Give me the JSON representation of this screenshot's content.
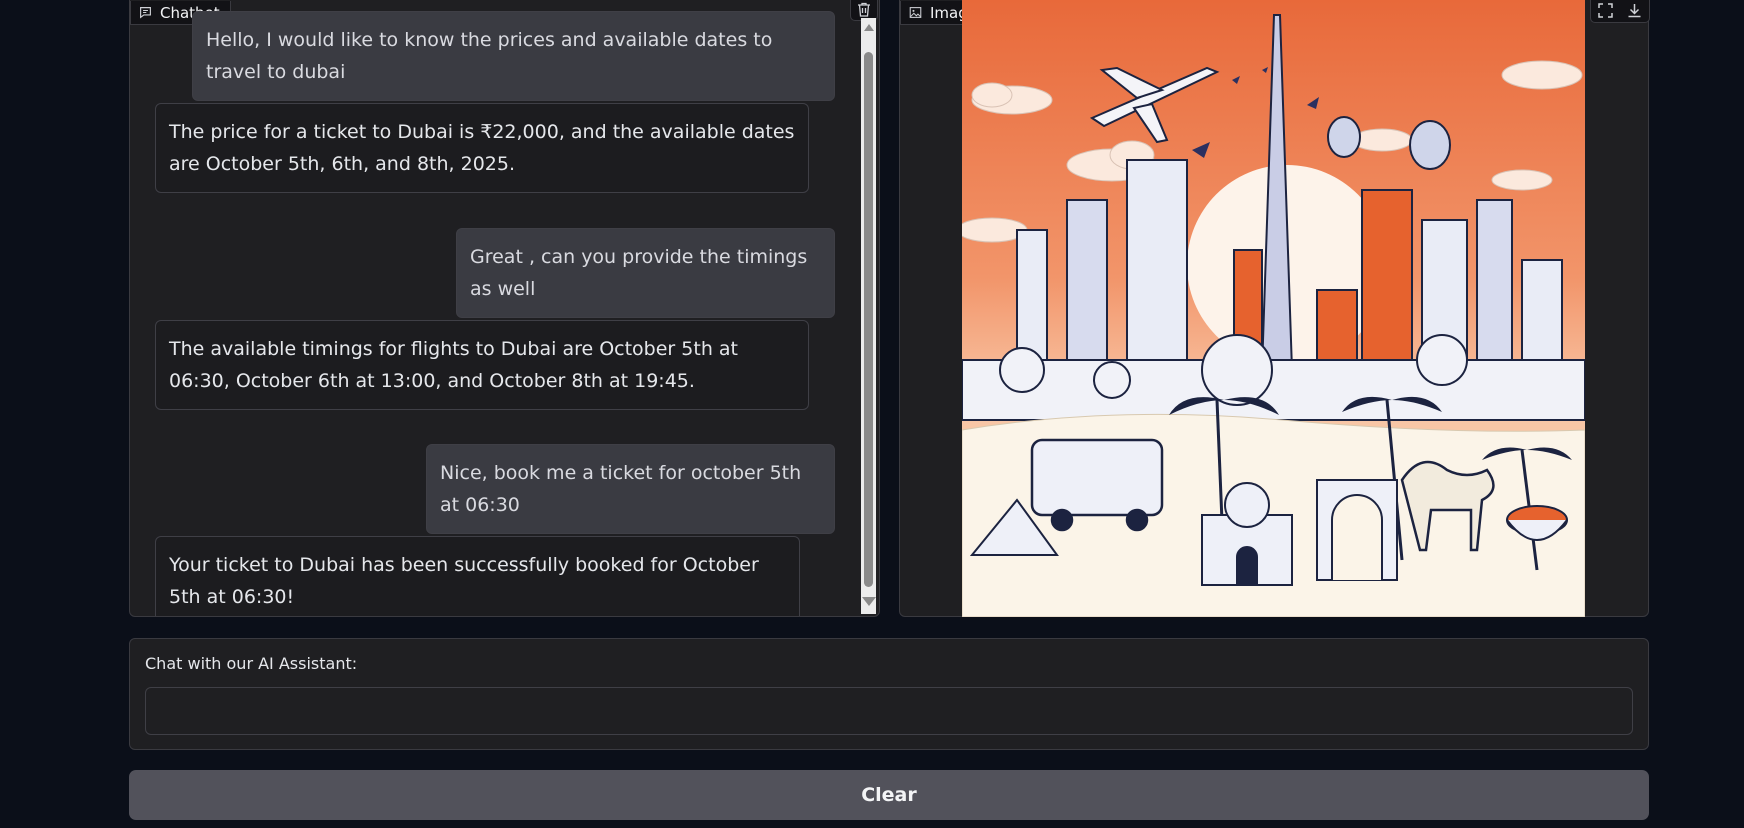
{
  "chatbot": {
    "label": "Chatbot",
    "messages": [
      {
        "role": "user",
        "text": "Hello, I would like to know the prices and available dates to travel to dubai"
      },
      {
        "role": "bot",
        "text": "The price for a ticket to Dubai is ₹22,000, and the available dates are October 5th, 6th, and 8th, 2025."
      },
      {
        "role": "user",
        "text": "Great , can you provide the timings as well"
      },
      {
        "role": "bot",
        "text": "The available timings for flights to Dubai are October 5th at 06:30, October 6th at 13:00, and October 8th at 19:45."
      },
      {
        "role": "user",
        "text": "Nice, book me a ticket for october 5th at 06:30"
      },
      {
        "role": "bot",
        "text": "Your ticket to Dubai has been successfully booked for October 5th at 06:30!"
      }
    ]
  },
  "image_panel": {
    "label": "Image",
    "illustration": "Dubai skyline illustration with airplane, hot air balloons, bus, camels and palm trees at sunset"
  },
  "input": {
    "label": "Chat with our AI Assistant:",
    "value": "",
    "placeholder": ""
  },
  "clear_button": {
    "label": "Clear"
  },
  "colors": {
    "background": "#0b0f19",
    "panel": "#1f1f22",
    "user_bubble": "#3a3b42",
    "bot_bubble": "#1c1c1f",
    "clear_button": "#52525b",
    "sunset_orange": "#ef7a3c"
  }
}
